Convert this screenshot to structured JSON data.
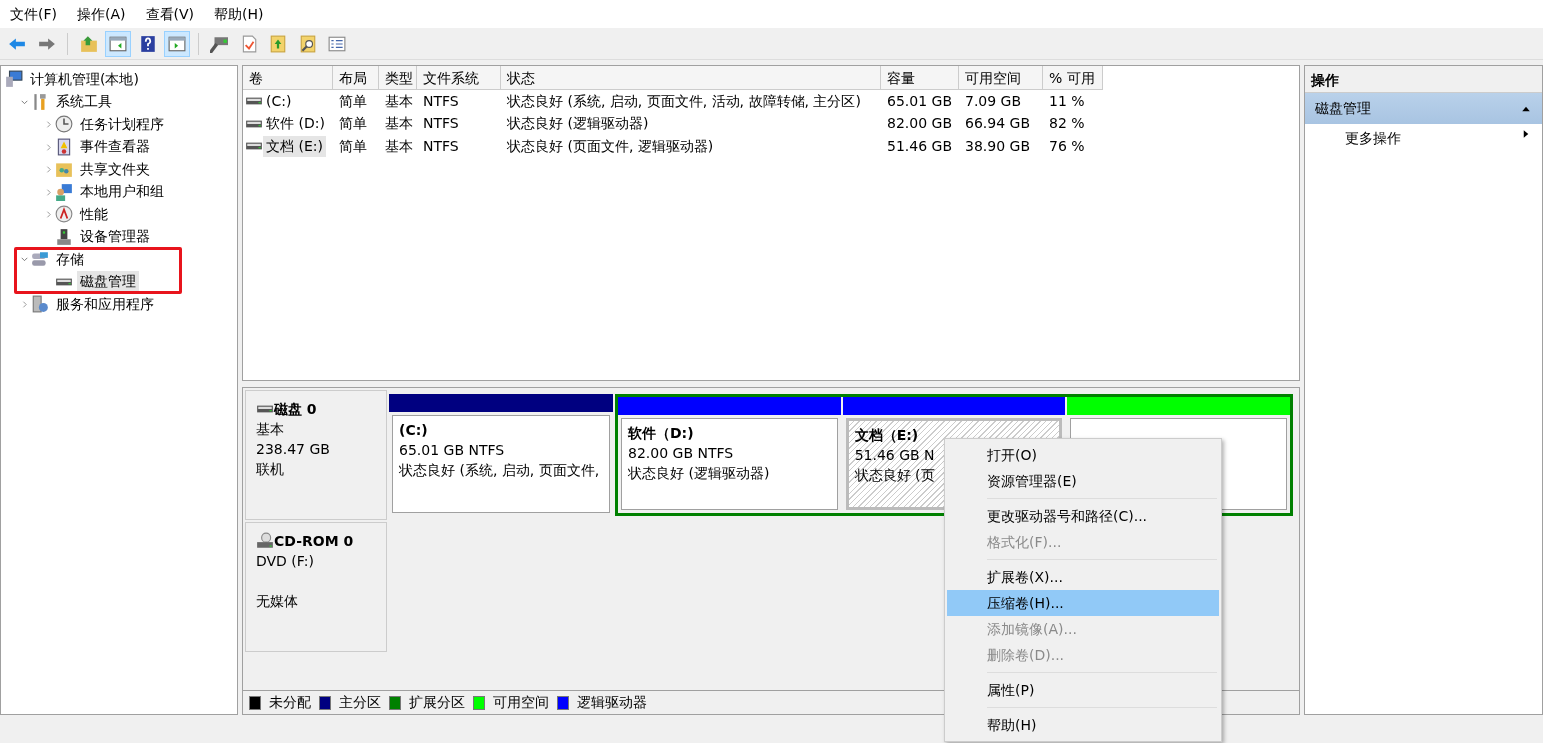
{
  "menu_bar": [
    "文件(F)",
    "操作(A)",
    "查看(V)",
    "帮助(H)"
  ],
  "toolbar": [
    {
      "kind": "back",
      "selected": false
    },
    {
      "kind": "forward",
      "selected": false
    },
    {
      "kind": "up",
      "selected": false
    },
    {
      "kind": "tree",
      "selected": true
    },
    {
      "kind": "help",
      "selected": false
    },
    {
      "kind": "pane",
      "selected": true
    },
    {
      "kind": "connect",
      "selected": false
    },
    {
      "kind": "check",
      "selected": false
    },
    {
      "kind": "export",
      "selected": false
    },
    {
      "kind": "find",
      "selected": false
    },
    {
      "kind": "list",
      "selected": false
    }
  ],
  "tree": {
    "label": "计算机管理(本地)",
    "kind": "computer",
    "selected": false,
    "children": [
      {
        "label": "系统工具",
        "kind": "tools",
        "expanded": true,
        "selected": false,
        "children": [
          {
            "label": "任务计划程序",
            "kind": "clock",
            "expanded": false,
            "selected": false
          },
          {
            "label": "事件查看器",
            "kind": "log",
            "expanded": false,
            "selected": false
          },
          {
            "label": "共享文件夹",
            "kind": "share",
            "expanded": false,
            "selected": false
          },
          {
            "label": "本地用户和组",
            "kind": "users",
            "expanded": false,
            "selected": false
          },
          {
            "label": "性能",
            "kind": "gauge",
            "expanded": false,
            "selected": false
          },
          {
            "label": "设备管理器",
            "kind": "device",
            "selected": false
          }
        ]
      },
      {
        "label": "存储",
        "kind": "storage",
        "expanded": true,
        "selected": false,
        "children": [
          {
            "label": "磁盘管理",
            "kind": "drive",
            "selected": true
          }
        ]
      },
      {
        "label": "服务和应用程序",
        "kind": "services",
        "expanded": false,
        "selected": false
      }
    ]
  },
  "annotation": {
    "color": "#e8141c"
  },
  "table": {
    "columns": [
      "卷",
      "布局",
      "类型",
      "文件系统",
      "状态",
      "容量",
      "可用空间",
      "% 可用"
    ],
    "rows": [
      {
        "selected": false,
        "cells": [
          "(C:)",
          "简单",
          "基本",
          "NTFS",
          "状态良好 (系统, 启动, 页面文件, 活动, 故障转储, 主分区)",
          "65.01 GB",
          "7.09 GB",
          "11 %"
        ]
      },
      {
        "selected": false,
        "cells": [
          "软件 (D:)",
          "简单",
          "基本",
          "NTFS",
          "状态良好 (逻辑驱动器)",
          "82.00 GB",
          "66.94 GB",
          "82 %"
        ]
      },
      {
        "selected": true,
        "cells": [
          "文档 (E:)",
          "简单",
          "基本",
          "NTFS",
          "状态良好 (页面文件, 逻辑驱动器)",
          "51.46 GB",
          "38.90 GB",
          "76 %"
        ]
      }
    ]
  },
  "disks": [
    {
      "kind": "disk",
      "name": "磁盘 0",
      "type": "基本",
      "size": "238.47 GB",
      "state": "联机",
      "partitions": [
        {
          "label": "(C:)",
          "size": "65.01 GB NTFS",
          "status": "状态良好 (系统, 启动, 页面文件,",
          "color": "#000080",
          "extended": false,
          "selected": false
        },
        {
          "label": "软件（D:)",
          "size": "82.00 GB NTFS",
          "status": "状态良好 (逻辑驱动器)",
          "color": "#0000ff",
          "extended": true,
          "selected": false
        },
        {
          "label": "文档（E:)",
          "size": "51.46 GB N",
          "status": "状态良好 (页",
          "color": "#0000ff",
          "extended": true,
          "selected": true
        },
        {
          "color": "#00ff00",
          "extended": true,
          "selected": false
        }
      ]
    },
    {
      "kind": "cdrom",
      "name": "CD-ROM 0",
      "drive": "DVD (F:)",
      "media": "无媒体"
    }
  ],
  "legend": [
    {
      "label": "未分配",
      "color": "#000000"
    },
    {
      "label": "主分区",
      "color": "#000080"
    },
    {
      "label": "扩展分区",
      "color": "#008000"
    },
    {
      "label": "可用空间",
      "color": "#00ff00"
    },
    {
      "label": "逻辑驱动器",
      "color": "#0000ff"
    }
  ],
  "actions": {
    "title": "操作",
    "section": {
      "label": "磁盘管理",
      "expanded": true
    },
    "items": [
      "更多操作"
    ]
  },
  "context_menu": [
    [
      {
        "label": "打开(O)",
        "disabled": false,
        "selected": false
      },
      {
        "label": "资源管理器(E)",
        "disabled": false,
        "selected": false
      }
    ],
    [
      {
        "label": "更改驱动器号和路径(C)...",
        "disabled": false,
        "selected": false
      },
      {
        "label": "格式化(F)...",
        "disabled": true,
        "selected": false
      }
    ],
    [
      {
        "label": "扩展卷(X)...",
        "disabled": false,
        "selected": false
      },
      {
        "label": "压缩卷(H)...",
        "disabled": false,
        "selected": true
      },
      {
        "label": "添加镜像(A)...",
        "disabled": true,
        "selected": false
      },
      {
        "label": "删除卷(D)...",
        "disabled": true,
        "selected": false
      }
    ],
    [
      {
        "label": "属性(P)",
        "disabled": false,
        "selected": false
      }
    ],
    [
      {
        "label": "帮助(H)",
        "disabled": false,
        "selected": false
      }
    ]
  ]
}
